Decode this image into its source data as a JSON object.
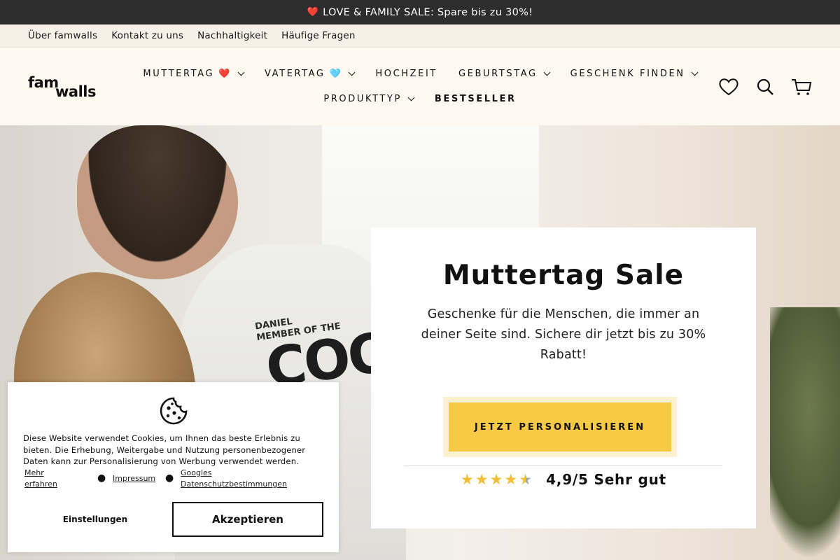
{
  "announcement": {
    "heart": "❤️",
    "text": "LOVE & FAMILY SALE: Spare bis zu 30%!"
  },
  "utility_nav": [
    "Über famwalls",
    "Kontakt zu uns",
    "Nachhaltigkeit",
    "Häufige Fragen"
  ],
  "logo": {
    "part1": "fam",
    "part2": "walls"
  },
  "nav": {
    "row1": [
      {
        "label": "MUTTERTAG",
        "emoji": "❤️"
      },
      {
        "label": "VATERTAG",
        "emoji": "🩵"
      },
      {
        "label": "HOCHZEIT"
      },
      {
        "label": "GEBURTSTAG"
      },
      {
        "label": "GESCHENK FINDEN"
      }
    ],
    "row2": [
      {
        "label": "PRODUKTTYP"
      },
      {
        "label": "BESTSELLER"
      }
    ]
  },
  "header_icons": [
    "heart-icon",
    "search-icon",
    "cart-icon"
  ],
  "hero": {
    "shirt_text_line1": "DANIEL",
    "shirt_text_line2": "MEMBER OF THE",
    "shirt_big_text": "COO"
  },
  "promo": {
    "title": "Muttertag Sale",
    "text": "Geschenke für die Menschen, die immer an deiner Seite sind. Sichere dir jetzt bis zu 30% Rabatt!",
    "cta": "JETZT PERSONALISIEREN",
    "rating_value": 4.9,
    "rating_text": "4,9/5 Sehr gut"
  },
  "cookie": {
    "text": "Diese Website verwendet Cookies, um Ihnen das beste Erlebnis zu bieten. Die Erhebung, Weitergabe und Nutzung personenbezogener Daten kann zur Personalisierung von Werbung verwendet werden.",
    "link_more_1": "Mehr",
    "link_more_2": "erfahren",
    "link_impressum": "Impressum",
    "link_privacy_1": "Googles",
    "link_privacy_2": "Datenschutzbestimmungen",
    "settings": "Einstellungen",
    "accept": "Akzeptieren"
  },
  "colors": {
    "accent": "#f8c945",
    "dark_bar": "#2d2d2d",
    "cream": "#fdf9f1"
  }
}
